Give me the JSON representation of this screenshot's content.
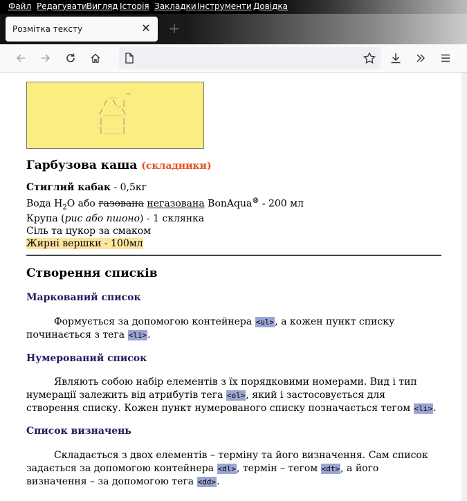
{
  "menu": [
    "Файл",
    "Редагувати",
    "Вигляд",
    "Історія",
    "Закладки",
    "Інструменти",
    "Довідка"
  ],
  "tab": {
    "title": "Розмітка тексту"
  },
  "icons": [
    "back-icon",
    "forward-icon",
    "reload-icon",
    "home-icon",
    "page-icon",
    "star-icon",
    "download-icon",
    "overflow-icon",
    "menu-icon"
  ],
  "colors": {
    "ascii_bg": "#fced81",
    "subtitle": "#e2521d",
    "heading": "#1c1c5c",
    "code_bg": "#9ba5d3",
    "highlight": "#ffe4a0"
  },
  "ascii_art": "   __  ~\n  / \\_|\n /____\\\n |    |\n |____|",
  "recipe": {
    "title": "Гарбузова каша",
    "subtitle": "(складники)",
    "item1_bold": "Стиглий кабак",
    "item1_rest": " - 0,5кг",
    "item2_a": "Вода H",
    "item2_sub": "2",
    "item2_b": "O або ",
    "item2_strike": "газована",
    "item2_under": "негазована",
    "item2_brand": " BonAqua",
    "item2_reg": "®",
    "item2_rest": " - 200 мл",
    "item3_a": "Крупа (",
    "item3_italic": "рис або пшоно",
    "item3_rest": ") - 1 склянка",
    "item4": "Сіль та цукор за смаком",
    "item5": "Жирні вершки - 100мл"
  },
  "lists": {
    "title": "Створення списків",
    "ul": {
      "title": "Маркований список",
      "t1": "Формується за допомогою контейнера ",
      "c1": "<ul>",
      "t2": ", а кожен пункт списку починається з тега ",
      "c2": "<li>",
      "t3": "."
    },
    "ol": {
      "title": "Нумерований список",
      "t1": "Являють собою набір елементів з їх порядковими номерами. Вид і тип нумерації залежить від атрибутів тега ",
      "c1": "<ol>",
      "t2": ", який і застосовується для створення списку. Кожен пункт нумерованого списку позначається тегом ",
      "c2": "<li>",
      "t3": "."
    },
    "dl": {
      "title": "Список визначень",
      "t1": "Складається з двох елементів – терміну та його визначення. Сам список задається за допомогою контейнера ",
      "c1": "<dl>",
      "t2": ", термін – тегом ",
      "c2": "<dt>",
      "t3": ", а його визначення – за допомогою тега ",
      "c3": "<dd>",
      "t4": "."
    }
  }
}
